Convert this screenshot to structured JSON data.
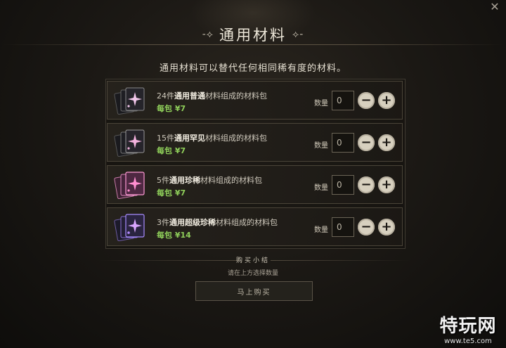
{
  "window": {
    "title": "通用材料",
    "title_ornament_left": "-⟡",
    "title_ornament_right": "⟡-",
    "close_glyph": "✕",
    "subtitle": "通用材料可以替代任何相同稀有度的材料。"
  },
  "items": [
    {
      "count": "24件",
      "highlight": "通用普通",
      "suffix": "材料组成的材料包",
      "price": "每包 ¥7",
      "qty_label": "数量",
      "qty_value": "0",
      "icon": "common-material-cards-icon",
      "accent": "#e6b8e0"
    },
    {
      "count": "15件",
      "highlight": "通用罕见",
      "suffix": "材料组成的材料包",
      "price": "每包 ¥7",
      "qty_label": "数量",
      "qty_value": "0",
      "icon": "uncommon-material-cards-icon",
      "accent": "#f0a8d8"
    },
    {
      "count": "5件",
      "highlight": "通用珍稀",
      "suffix": "材料组成的材料包",
      "price": "每包 ¥7",
      "qty_label": "数量",
      "qty_value": "0",
      "icon": "rare-material-cards-icon",
      "accent": "#ff8ed0"
    },
    {
      "count": "3件",
      "highlight": "通用超级珍稀",
      "suffix": "材料组成的材料包",
      "price": "每包 ¥14",
      "qty_label": "数量",
      "qty_value": "0",
      "icon": "epic-material-cards-icon",
      "accent": "#b58cff"
    }
  ],
  "controls": {
    "minus": "−",
    "plus": "+"
  },
  "summary": {
    "heading": "购买小结",
    "note": "请在上方选择数量",
    "buy_label": "马上购买"
  },
  "watermark": {
    "big": "特玩网",
    "small": "www.te5.com"
  }
}
